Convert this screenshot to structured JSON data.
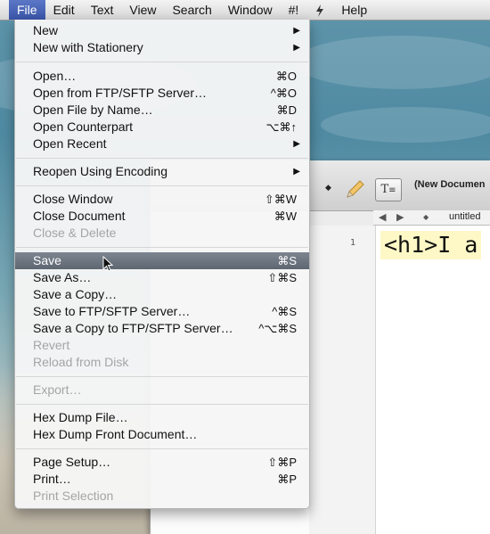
{
  "menubar": {
    "items": [
      "",
      "File",
      "Edit",
      "Text",
      "View",
      "Search",
      "Window",
      "#!",
      "",
      "Help"
    ],
    "active_index": 1,
    "script_icon": "script-menu-icon"
  },
  "file_menu": {
    "items": {
      "new": {
        "label": "New",
        "shortcut": ""
      },
      "new_stationery": {
        "label": "New with Stationery",
        "shortcut": ""
      },
      "open": {
        "label": "Open…",
        "shortcut": "⌘O"
      },
      "open_ftp": {
        "label": "Open from FTP/SFTP Server…",
        "shortcut": "^⌘O"
      },
      "open_by_name": {
        "label": "Open File by Name…",
        "shortcut": "⌘D"
      },
      "open_counterpart": {
        "label": "Open Counterpart",
        "shortcut": "⌥⌘↑"
      },
      "open_recent": {
        "label": "Open Recent",
        "shortcut": ""
      },
      "reopen_encoding": {
        "label": "Reopen Using Encoding",
        "shortcut": ""
      },
      "close_window": {
        "label": "Close Window",
        "shortcut": "⇧⌘W"
      },
      "close_document": {
        "label": "Close Document",
        "shortcut": "⌘W"
      },
      "close_delete": {
        "label": "Close & Delete",
        "shortcut": ""
      },
      "save": {
        "label": "Save",
        "shortcut": "⌘S"
      },
      "save_as": {
        "label": "Save As…",
        "shortcut": "⇧⌘S"
      },
      "save_copy": {
        "label": "Save a Copy…",
        "shortcut": ""
      },
      "save_ftp": {
        "label": "Save to FTP/SFTP Server…",
        "shortcut": "^⌘S"
      },
      "save_copy_ftp": {
        "label": "Save a Copy to FTP/SFTP Server…",
        "shortcut": "^⌥⌘S"
      },
      "revert": {
        "label": "Revert",
        "shortcut": ""
      },
      "reload": {
        "label": "Reload from Disk",
        "shortcut": ""
      },
      "export": {
        "label": "Export…",
        "shortcut": ""
      },
      "hex_file": {
        "label": "Hex Dump File…",
        "shortcut": ""
      },
      "hex_front": {
        "label": "Hex Dump Front Document…",
        "shortcut": ""
      },
      "page_setup": {
        "label": "Page Setup…",
        "shortcut": "⇧⌘P"
      },
      "print": {
        "label": "Print…",
        "shortcut": "⌘P"
      },
      "print_selection": {
        "label": "Print Selection",
        "shortcut": ""
      }
    },
    "highlighted": "Save"
  },
  "document": {
    "title": "(New Documen",
    "nav_label": "untitled",
    "line_number": "1",
    "code_text": "<h1>I a"
  },
  "colors": {
    "menu_active": "#3a55a8",
    "highlight": "#6a727d",
    "code_highlight": "#fdf8c6"
  }
}
